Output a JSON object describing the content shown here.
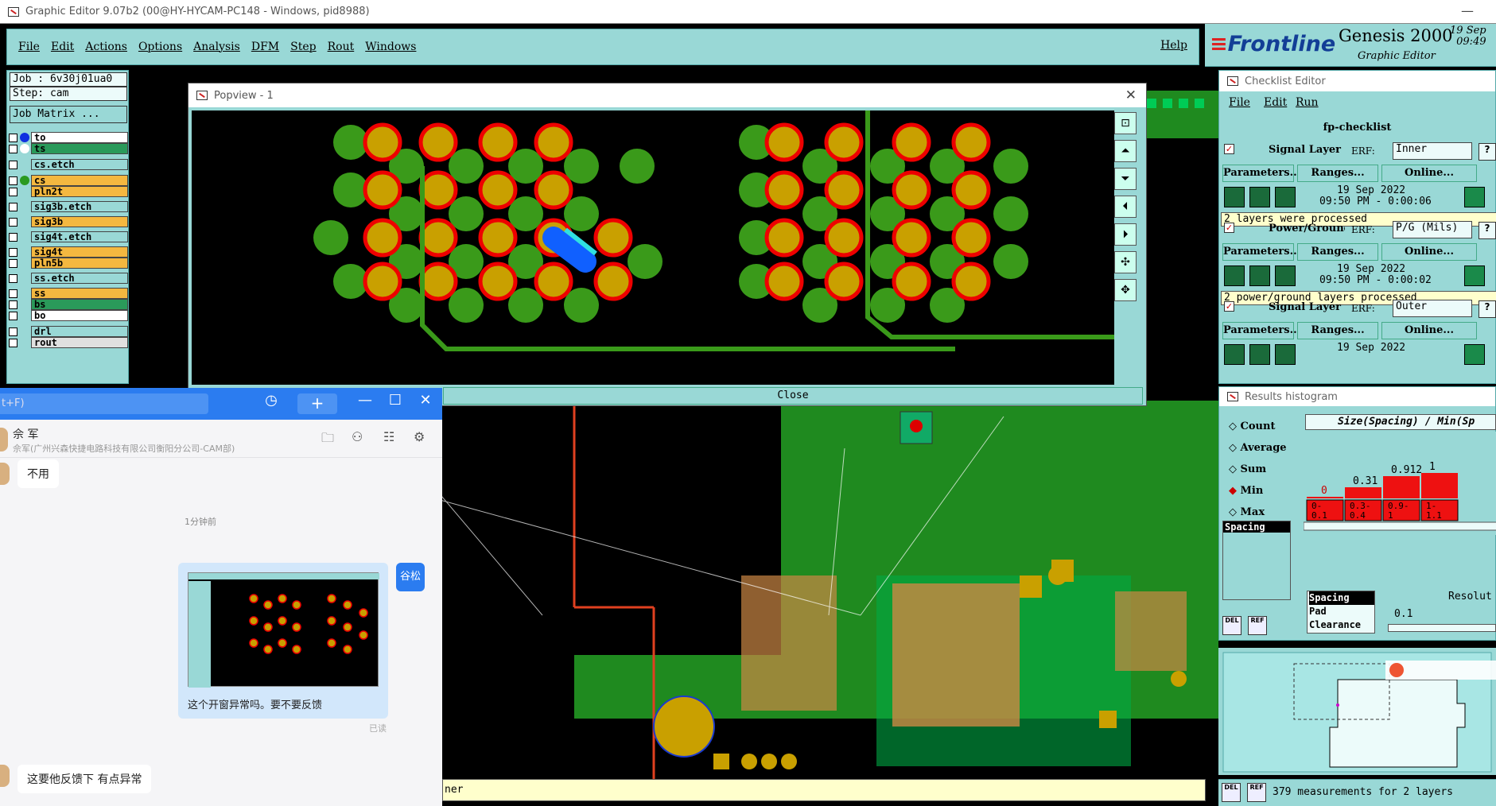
{
  "window": {
    "title": "Graphic Editor 9.07b2 (00@HY-HYCAM-PC148 - Windows, pid8988)"
  },
  "menu": {
    "items": [
      "File",
      "Edit",
      "Actions",
      "Options",
      "Analysis",
      "DFM",
      "Step",
      "Rout",
      "Windows"
    ],
    "help": "Help"
  },
  "brand": {
    "logo_pre": "F",
    "logo": "rontline",
    "title": "Genesis 2000",
    "subtitle": "Graphic Editor",
    "date": "19  Sep",
    "time": "09:49"
  },
  "job": {
    "job": "Job  :  6v30j01ua0",
    "step": "Step:  cam",
    "matrix_button": "Job Matrix ..."
  },
  "layers": [
    {
      "name": "to",
      "color": "#ffffff",
      "dot": "#1030e0"
    },
    {
      "name": "ts",
      "color": "#2a9a5a",
      "dot": "#ffffff"
    },
    {
      "name": "cs.etch",
      "color": "#99d8d6",
      "dot": ""
    },
    {
      "name": "cs",
      "color": "#f4b840",
      "dot": "#2a9a20"
    },
    {
      "name": "pln2t",
      "color": "#f4b840",
      "dot": ""
    },
    {
      "name": "sig3b.etch",
      "color": "#99d8d6",
      "dot": ""
    },
    {
      "name": "sig3b",
      "color": "#f4b840",
      "dot": ""
    },
    {
      "name": "sig4t.etch",
      "color": "#99d8d6",
      "dot": ""
    },
    {
      "name": "sig4t",
      "color": "#f4b840",
      "dot": ""
    },
    {
      "name": "pln5b",
      "color": "#f4b840",
      "dot": ""
    },
    {
      "name": "ss.etch",
      "color": "#99d8d6",
      "dot": ""
    },
    {
      "name": "ss",
      "color": "#f4b840",
      "dot": ""
    },
    {
      "name": "bs",
      "color": "#2a9a5a",
      "dot": ""
    },
    {
      "name": "bo",
      "color": "#ffffff",
      "dot": ""
    },
    {
      "name": "drl",
      "color": "#99d8d6",
      "dot": ""
    },
    {
      "name": "rout",
      "color": "#e0e0e0",
      "dot": ""
    }
  ],
  "popview": {
    "title": "Popview - 1",
    "close_label": "Close"
  },
  "checklist": {
    "title": "Checklist Editor",
    "menu": [
      "File",
      "Edit",
      "Run"
    ],
    "name": "fp-checklist",
    "sections": [
      {
        "name": "Signal Layer Ch",
        "erf_label": "ERF:",
        "erf": "Inner",
        "params": "Parameters...",
        "ranges": "Ranges...",
        "online": "Online...",
        "date": "19  Sep  2022",
        "time": "09:50 PM - 0:00:06",
        "message": "2 layers were processed"
      },
      {
        "name": "Power/Ground C",
        "erf_label": "ERF:",
        "erf": "P/G (Mils)",
        "params": "Parameters...",
        "ranges": "Ranges...",
        "online": "Online...",
        "date": "19  Sep  2022",
        "time": "09:50 PM - 0:00:02",
        "message": "2 power/ground layers processed"
      },
      {
        "name": "Signal Layer Ch",
        "erf_label": "ERF:",
        "erf": "Outer",
        "params": "Parameters...",
        "ranges": "Ranges...",
        "online": "Online...",
        "date": "19  Sep  2022",
        "time": "",
        "message": ""
      }
    ]
  },
  "histogram": {
    "title": "Results histogram",
    "options": [
      "Count",
      "Average",
      "Sum",
      "Min",
      "Max"
    ],
    "selected": "Min",
    "list_item": "Spacing",
    "header": "Size(Spacing) / Min(Sp",
    "bar_values": [
      "0",
      "0.31",
      "0.912",
      "1"
    ],
    "bins": [
      "0-\n0.1",
      "0.3-\n0.4",
      "0.9-\n1",
      "1-\n1.1"
    ],
    "types": [
      "Spacing",
      "Pad",
      "Clearance"
    ],
    "resolution_label": "Resolut",
    "resolution_value": "0.1",
    "del": "DEL",
    "ref": "REF"
  },
  "bottom": {
    "status": "379 measurements for 2 layers",
    "del": "DEL",
    "ref": "REF",
    "left_status": "ner"
  },
  "chat": {
    "search_hint": "t+F)",
    "contact_name": "佘 军",
    "contact_org": "佘军(广州兴森快捷电路科技有限公司衡阳分公司-CAM部)",
    "msg1": "不用",
    "time_label": "1分钟前",
    "sender_tag": "谷松",
    "image_caption": "这个开窗异常吗。要不要反馈",
    "read_status": "已读",
    "msg2": "这要他反馈下 有点异常"
  }
}
